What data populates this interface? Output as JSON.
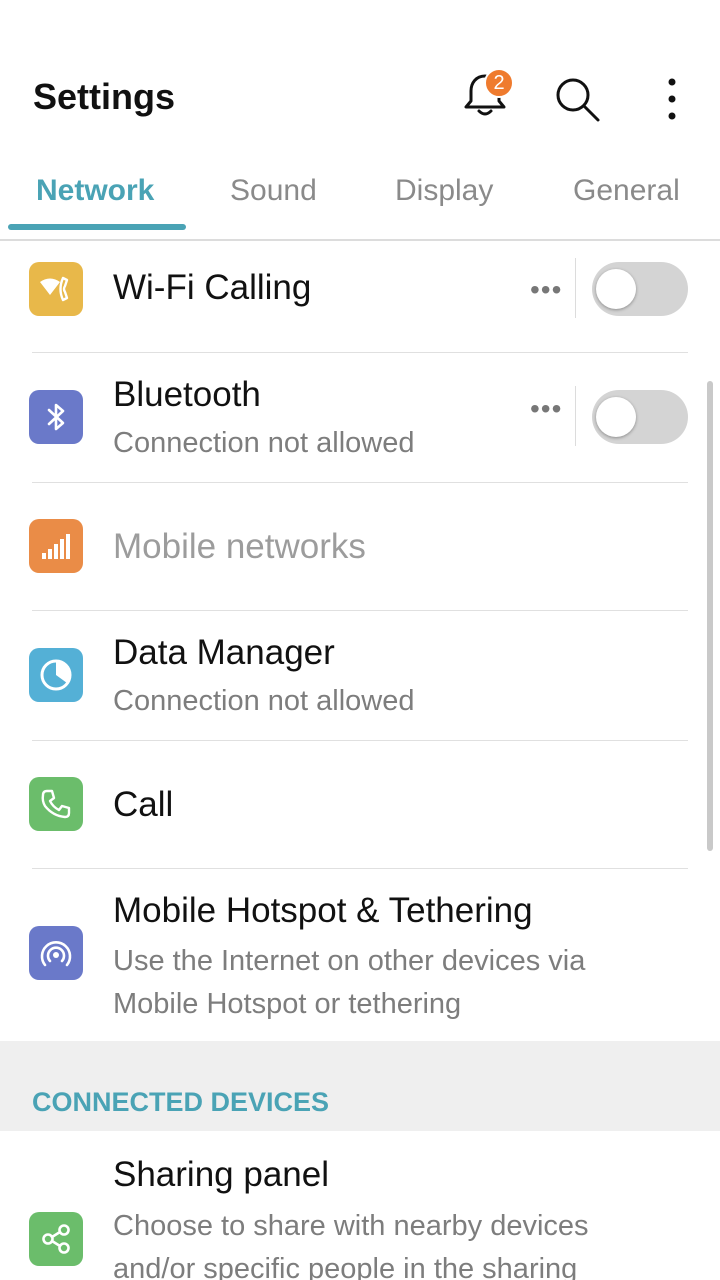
{
  "header": {
    "title": "Settings",
    "notification_count": "2",
    "icons": [
      "bell-icon",
      "search-icon",
      "more-vert-icon"
    ]
  },
  "tabs": [
    {
      "label": "Network",
      "active": true
    },
    {
      "label": "Sound",
      "active": false
    },
    {
      "label": "Display",
      "active": false
    },
    {
      "label": "General",
      "active": false
    }
  ],
  "network": {
    "items": [
      {
        "title": "Wi-Fi Calling",
        "icon": "wifi-calling-icon",
        "icon_color": "#e8b84a",
        "more": "•••",
        "toggle_on": false
      },
      {
        "title": "Bluetooth",
        "subtitle": "Connection not allowed",
        "icon": "bluetooth-icon",
        "icon_color": "#6a79c9",
        "more": "•••",
        "toggle_on": false
      },
      {
        "title": "Mobile networks",
        "icon": "signal-bars-icon",
        "icon_color": "#ea8c47",
        "disabled": true
      },
      {
        "title": "Data Manager",
        "subtitle": "Connection not allowed",
        "icon": "data-usage-icon",
        "icon_color": "#54b0d6"
      },
      {
        "title": "Call",
        "icon": "phone-icon",
        "icon_color": "#6bbd6b"
      },
      {
        "title": "Mobile Hotspot & Tethering",
        "subtitle": "Use the Internet on other devices via Mobile Hotspot or tethering",
        "icon": "hotspot-icon",
        "icon_color": "#6a79c9"
      }
    ]
  },
  "connected_devices": {
    "section_label": "CONNECTED DEVICES",
    "items": [
      {
        "title": "Sharing panel",
        "subtitle": "Choose to share with nearby devices and/or specific people in the sharing",
        "icon": "share-icon",
        "icon_color": "#6bbd6b"
      }
    ]
  },
  "colors": {
    "accent": "#4aa3b5",
    "badge": "#ef7b2e",
    "toggle_off": "#d4d4d4"
  }
}
